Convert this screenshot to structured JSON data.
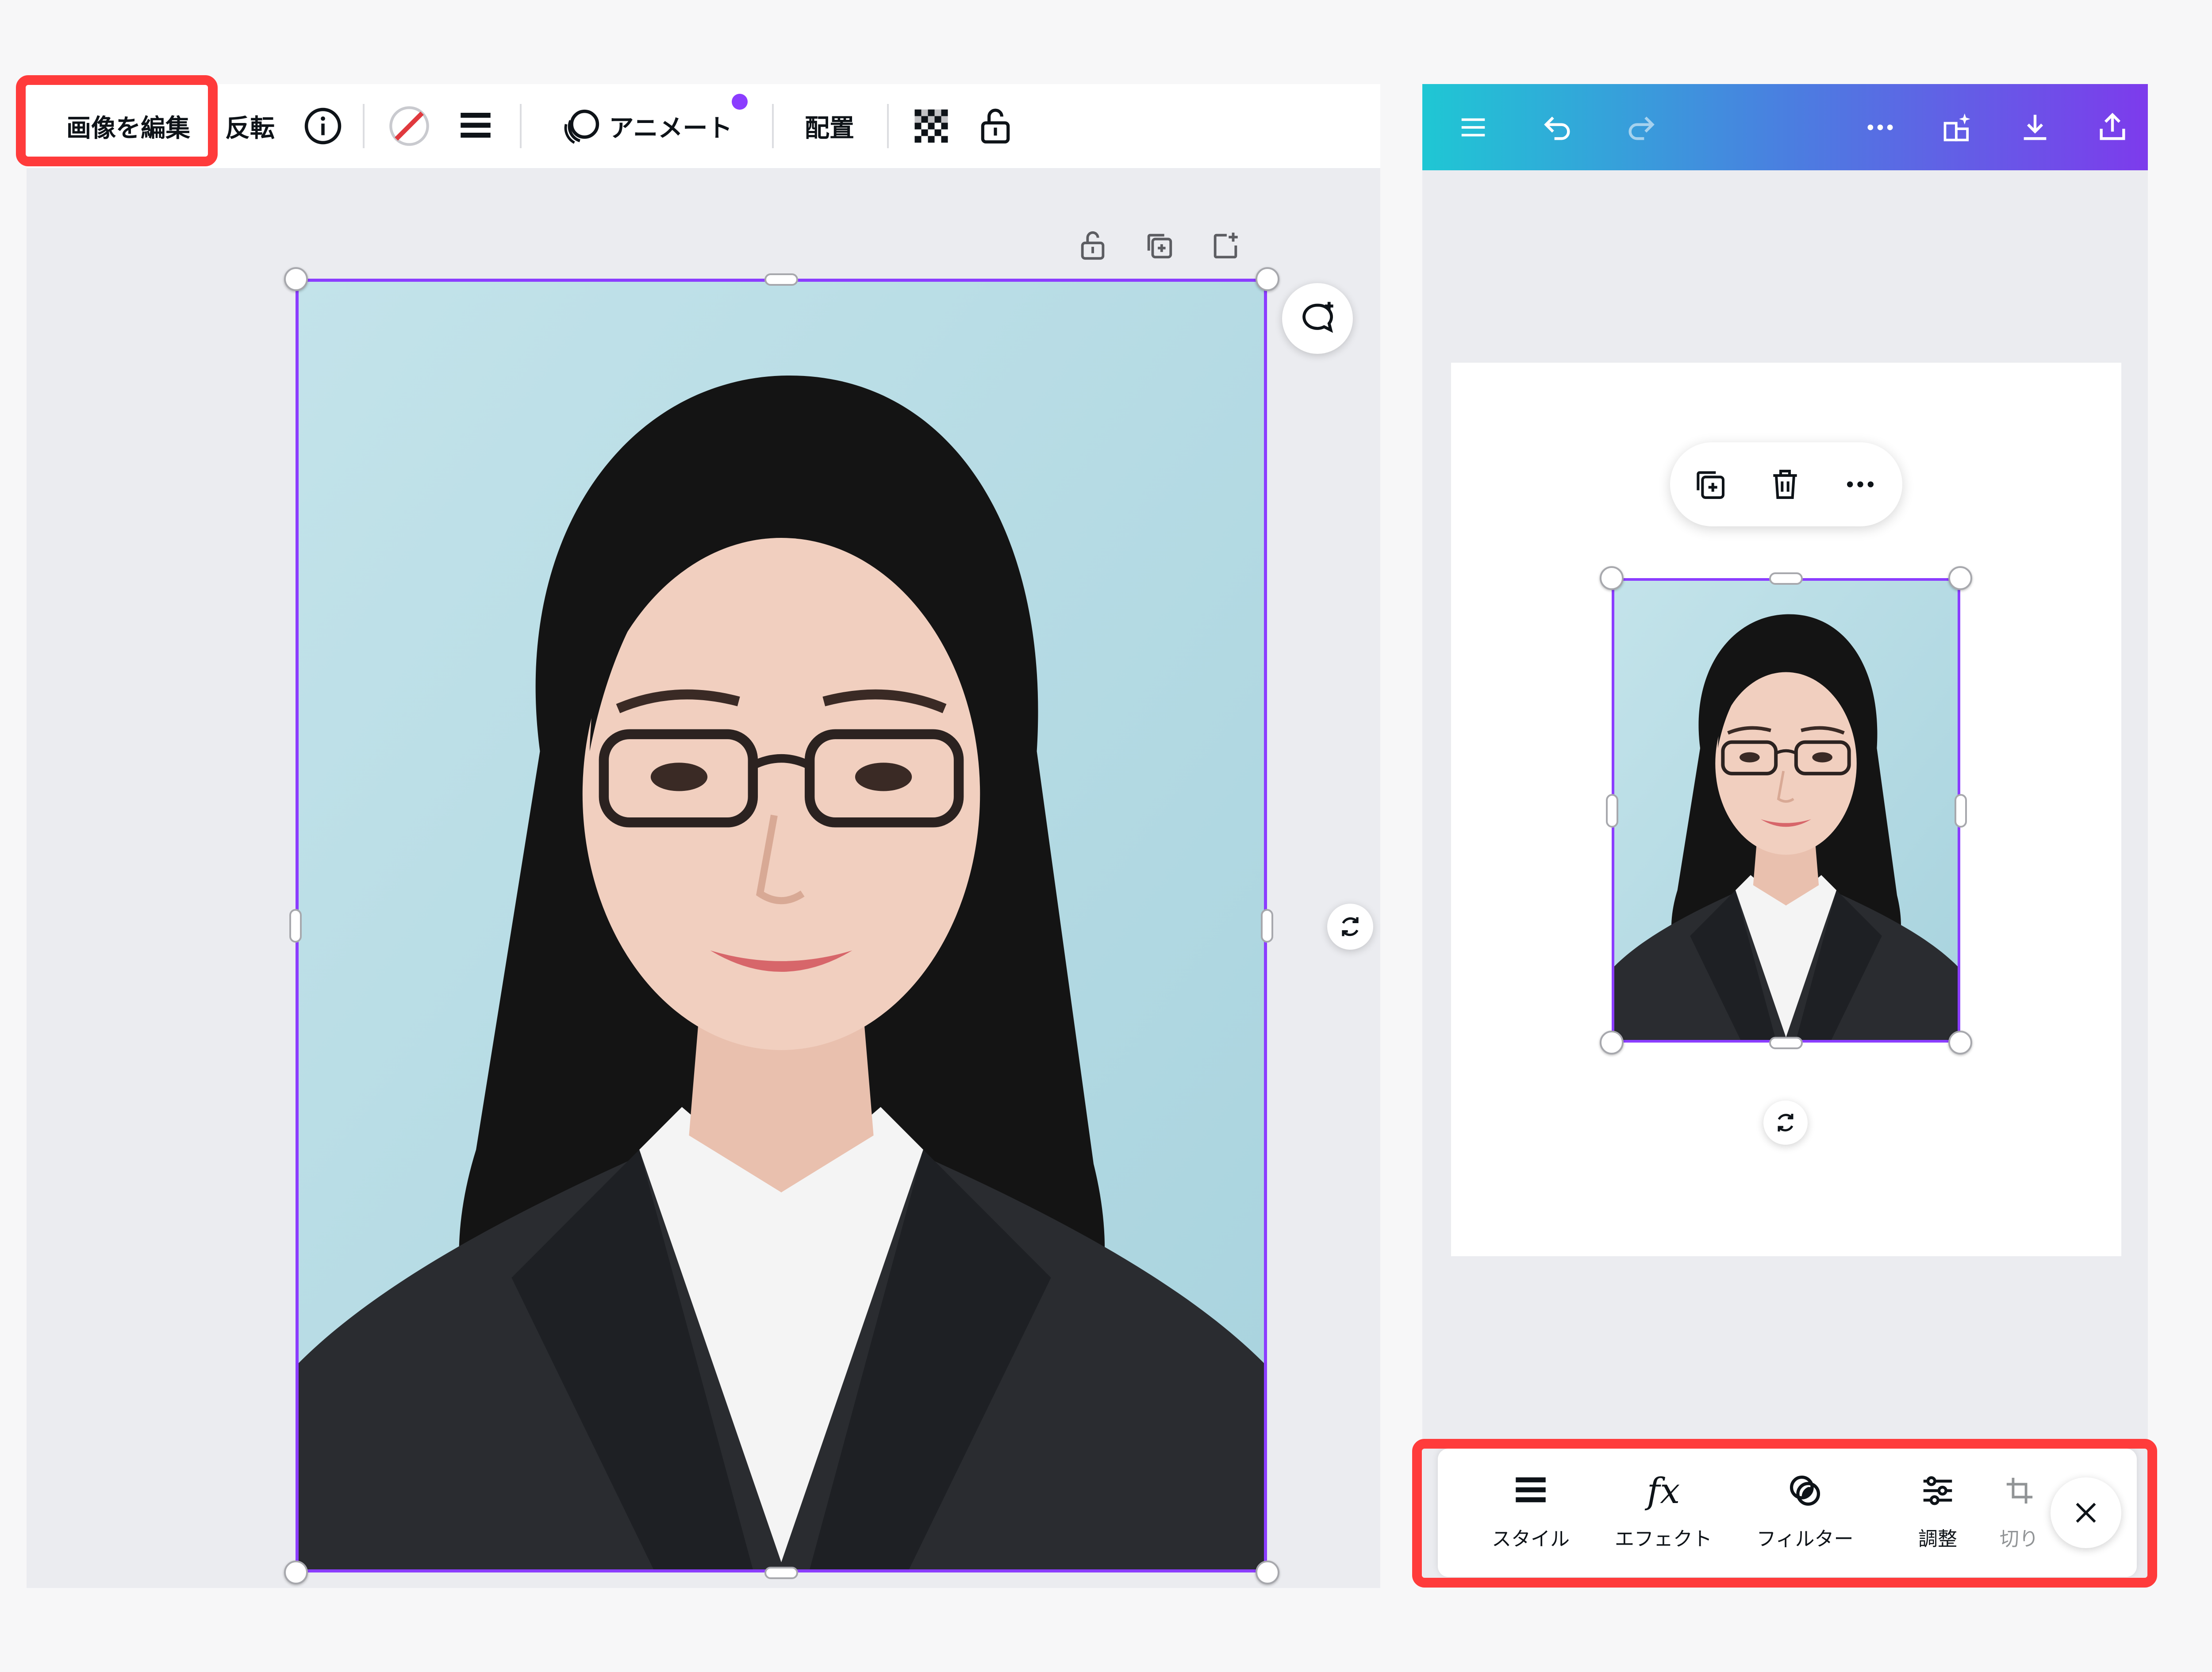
{
  "left_toolbar": {
    "edit_image_label": "画像を編集",
    "flip_label": "反転",
    "animate_label": "アニメート",
    "position_label": "配置"
  },
  "mobile_bottom_bar": {
    "items": [
      {
        "label": "スタイル",
        "icon": "style-lines-icon"
      },
      {
        "label": "エフェクト",
        "icon": "fx-icon"
      },
      {
        "label": "フィルター",
        "icon": "filter-icon"
      },
      {
        "label": "調整",
        "icon": "sliders-icon"
      },
      {
        "label": "切り",
        "icon": "crop-icon"
      }
    ],
    "effects_icon_text": "fx"
  },
  "colors": {
    "selection": "#8b3dff",
    "highlight": "#ff3b3b",
    "header_gradient": [
      "#1fc7d4",
      "#4a7fe0",
      "#7d3bec"
    ],
    "canvas_bg": "#ebecf0"
  }
}
